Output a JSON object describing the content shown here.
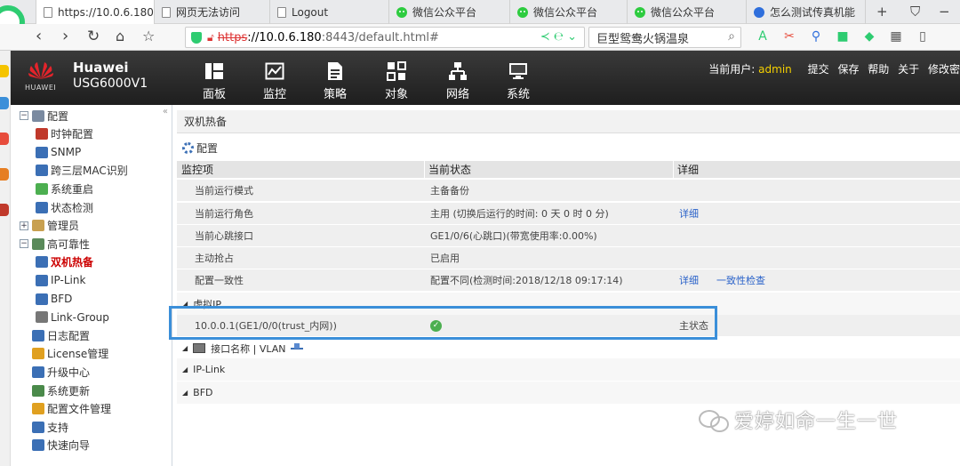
{
  "browser": {
    "tabs": [
      {
        "title": "https://10.0.6.180",
        "icon": "doc-icon",
        "active": true
      },
      {
        "title": "网页无法访问",
        "icon": "doc-icon"
      },
      {
        "title": "Logout",
        "icon": "doc-icon"
      },
      {
        "title": "微信公众平台",
        "icon": "wechat-icon"
      },
      {
        "title": "微信公众平台",
        "icon": "wechat-icon"
      },
      {
        "title": "微信公众平台",
        "icon": "wechat-icon"
      },
      {
        "title": "怎么测试传真机能",
        "icon": "paw-icon"
      }
    ],
    "url": {
      "scheme": "https",
      "host": "://10.0.6.180",
      "path": ":8443/default.html#"
    },
    "search_text": "巨型鸳鸯火锅温泉"
  },
  "header": {
    "brand": "Huawei",
    "logo_text": "HUAWEI",
    "model": "USG6000V1",
    "menu": [
      {
        "label": "面板",
        "icon": "dashboard-icon"
      },
      {
        "label": "监控",
        "icon": "monitor-icon"
      },
      {
        "label": "策略",
        "icon": "policy-icon"
      },
      {
        "label": "对象",
        "icon": "object-icon"
      },
      {
        "label": "网络",
        "icon": "network-icon"
      },
      {
        "label": "系统",
        "icon": "system-icon"
      }
    ],
    "user_label": "当前用户:",
    "user": "admin",
    "links": [
      "提交",
      "保存",
      "帮助",
      "关于",
      "修改密"
    ]
  },
  "sidebar": {
    "items": [
      {
        "label": "配置",
        "level": 0,
        "expander": "−",
        "color": "#7a8aa0"
      },
      {
        "label": "时钟配置",
        "level": 1,
        "color": "#c0392b"
      },
      {
        "label": "SNMP",
        "level": 1,
        "color": "#3b6fb5"
      },
      {
        "label": "跨三层MAC识别",
        "level": 1,
        "color": "#3b6fb5"
      },
      {
        "label": "系统重启",
        "level": 1,
        "color": "#4caf50"
      },
      {
        "label": "状态检测",
        "level": 1,
        "color": "#3b6fb5"
      },
      {
        "label": "管理员",
        "level": 0,
        "expander": "+",
        "color": "#c8a050"
      },
      {
        "label": "高可靠性",
        "level": 0,
        "expander": "−",
        "color": "#5a8a5a"
      },
      {
        "label": "双机热备",
        "level": 1,
        "color": "#3b6fb5",
        "active": true
      },
      {
        "label": "IP-Link",
        "level": 1,
        "color": "#3b6fb5"
      },
      {
        "label": "BFD",
        "level": 1,
        "color": "#3b6fb5"
      },
      {
        "label": "Link-Group",
        "level": 1,
        "color": "#777"
      },
      {
        "label": "日志配置",
        "level": 0,
        "color": "#3b6fb5"
      },
      {
        "label": "License管理",
        "level": 0,
        "color": "#e0a020"
      },
      {
        "label": "升级中心",
        "level": 0,
        "color": "#3b6fb5"
      },
      {
        "label": "系统更新",
        "level": 0,
        "color": "#4a8a4a"
      },
      {
        "label": "配置文件管理",
        "level": 0,
        "color": "#e0a020"
      },
      {
        "label": "支持",
        "level": 0,
        "color": "#3b6fb5"
      },
      {
        "label": "快速向导",
        "level": 0,
        "color": "#3b6fb5"
      }
    ]
  },
  "main": {
    "title": "双机热备",
    "config_label": "配置",
    "columns": [
      "监控项",
      "当前状态",
      "详细"
    ],
    "rows": [
      {
        "item": "当前运行模式",
        "status": "主备备份",
        "detail": "",
        "detail2": ""
      },
      {
        "item": "当前运行角色",
        "status": "主用 (切换后运行的时间: 0 天 0 时 0 分)",
        "detail": "详细",
        "detail2": ""
      },
      {
        "item": "当前心跳接口",
        "status": "GE1/0/6(心跳口)(带宽使用率:0.00%)",
        "detail": "",
        "detail2": ""
      },
      {
        "item": "主动抢占",
        "status": "已启用",
        "detail": "",
        "detail2": ""
      },
      {
        "item": "配置一致性",
        "status": "配置不同(检测时间:2018/12/18 09:17:14)",
        "detail": "详细",
        "detail2": "一致性检查"
      }
    ],
    "vip_section": "虚拟IP",
    "vip_row": {
      "item": "10.0.0.1(GE1/0/0(trust_内网))",
      "detail": "主状态"
    },
    "iface_section": "接口名称 | VLAN",
    "iplink_section": "IP-Link",
    "bfd_section": "BFD"
  },
  "watermark": "爱婷如命一生一世"
}
